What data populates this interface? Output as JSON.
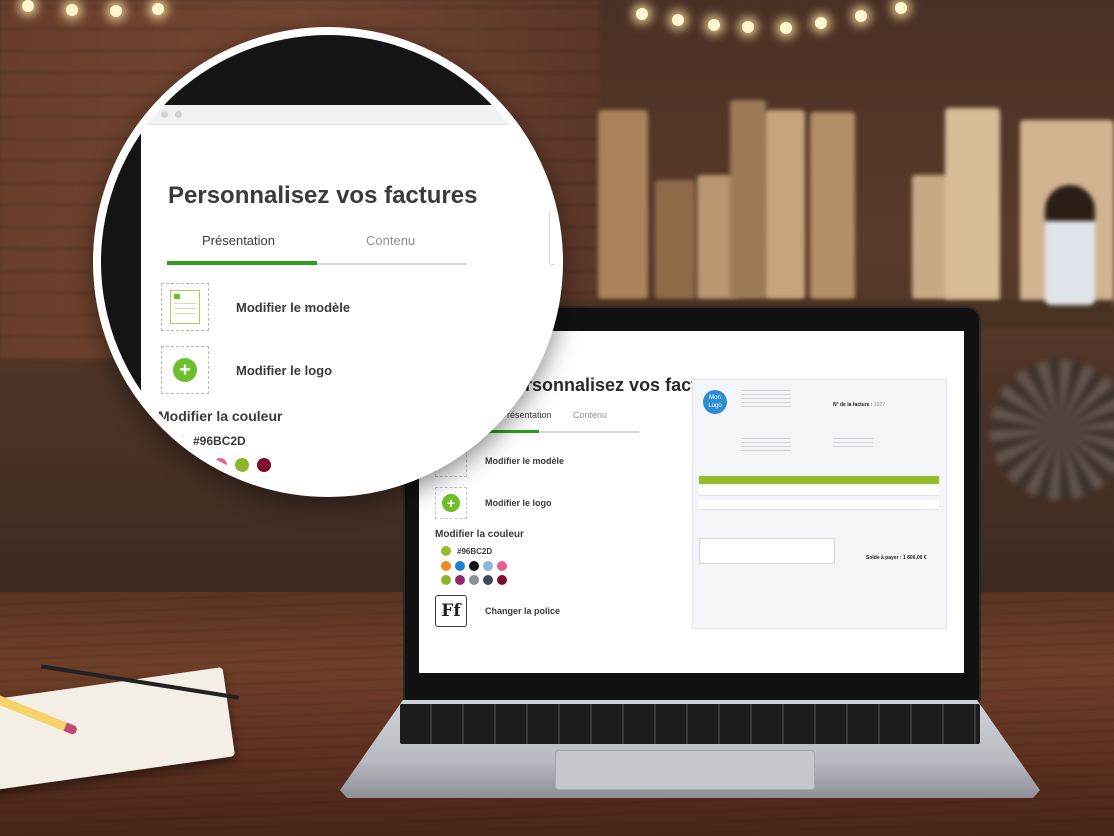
{
  "app": {
    "page_title": "Personnalisez vos factures",
    "tabs": [
      {
        "label": "Présentation",
        "active": true
      },
      {
        "label": "Contenu",
        "active": false
      }
    ],
    "options": {
      "template_label": "Modifier le modèle",
      "logo_label": "Modifier le logo",
      "color_title": "Modifier la couleur",
      "color_value": "#96BC2D",
      "font_label": "Changer la police",
      "font_icon_text": "Ff"
    },
    "swatches": [
      "#f08a1c",
      "#1f7fcf",
      "#111111",
      "#8fb4d9",
      "#e85f92",
      "#8bb62c",
      "#8e2a74",
      "#8a8f98",
      "#3b4a5a",
      "#7a0e2a"
    ],
    "zoom_swatches": [
      "#111111",
      "#a8c0de",
      "#e85f92",
      "#8bb62c",
      "#7a0e2a"
    ]
  },
  "invoice_preview": {
    "logo_text_line1": "Mon",
    "logo_text_line2": "Logo",
    "invoice_number_label": "N° de la facture :",
    "invoice_number": "1027",
    "total_label": "Solde à payer : 1 800,00 €"
  },
  "accent_color": "#96BC2D",
  "brand_green": "#2CA01C"
}
